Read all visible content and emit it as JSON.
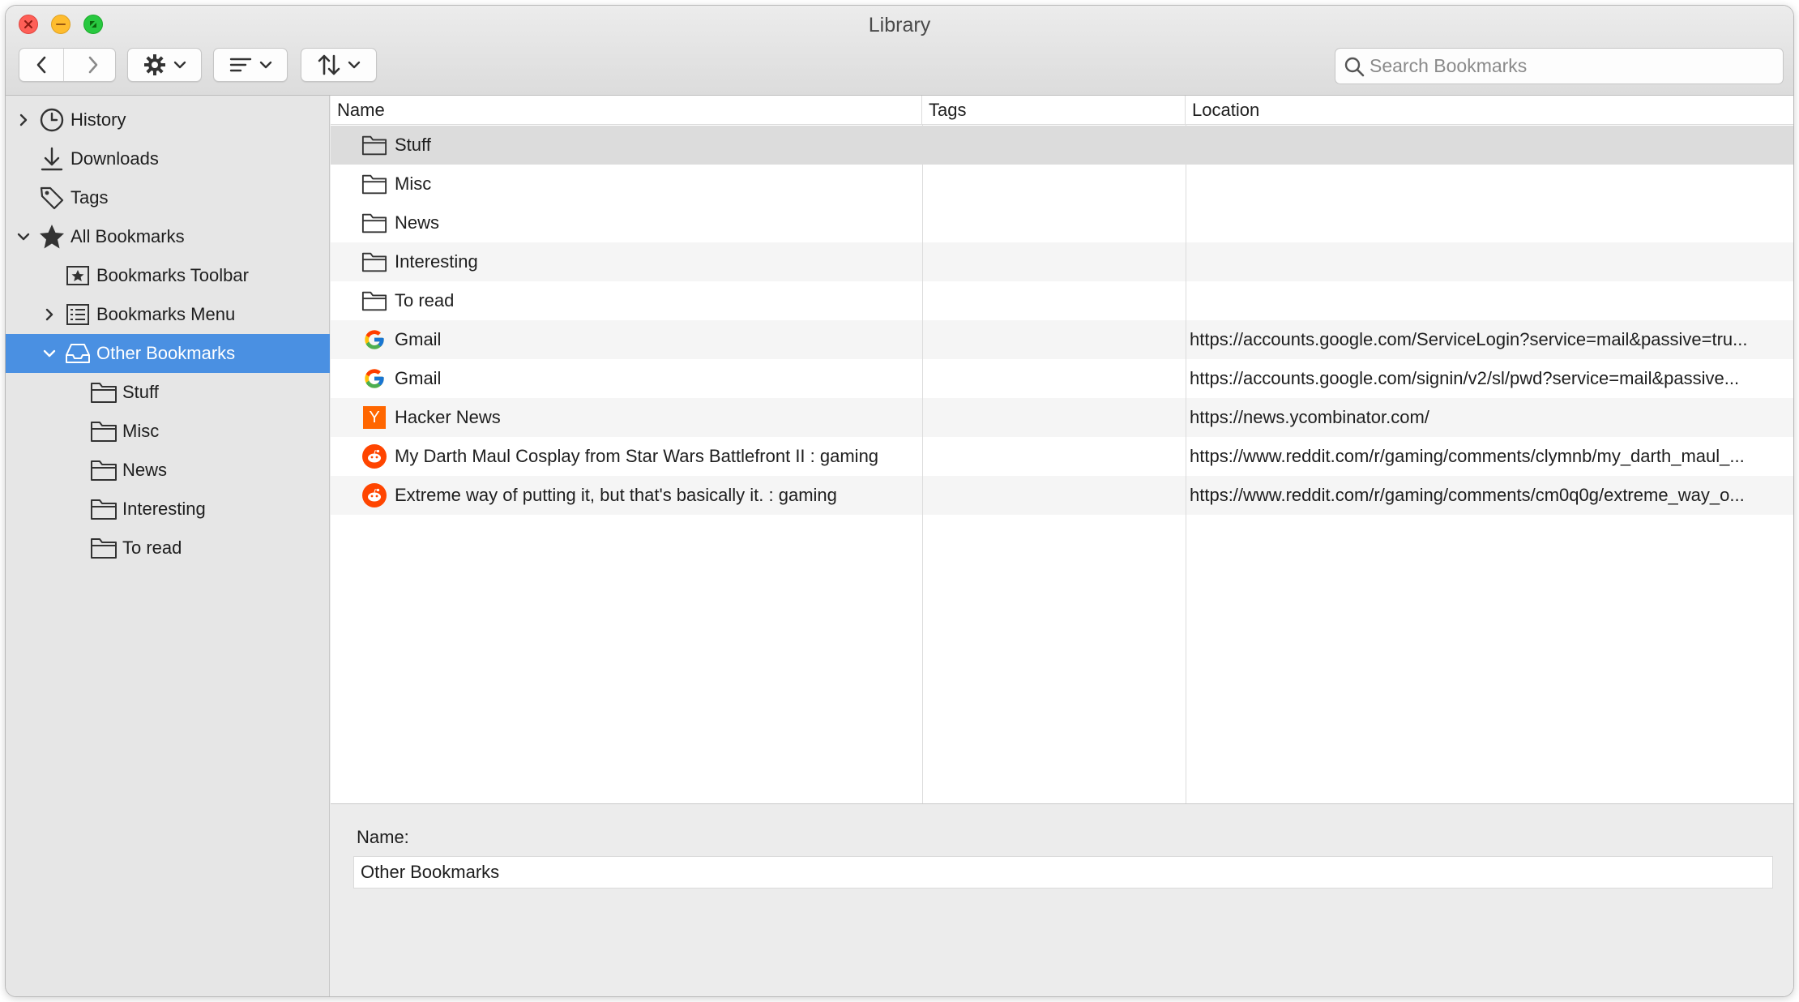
{
  "window": {
    "title": "Library"
  },
  "toolbar": {
    "back_icon": "chevron-left-icon",
    "forward_icon": "chevron-right-icon",
    "organize_icon": "gear-icon",
    "views_icon": "list-icon",
    "import_export_icon": "arrows-updown-icon",
    "search_placeholder": "Search Bookmarks"
  },
  "sidebar": {
    "items": [
      {
        "label": "History",
        "icon": "clock-icon"
      },
      {
        "label": "Downloads",
        "icon": "download-icon"
      },
      {
        "label": "Tags",
        "icon": "tag-icon"
      },
      {
        "label": "All Bookmarks",
        "icon": "star-icon"
      },
      {
        "label": "Bookmarks Toolbar",
        "icon": "bookmark-toolbar-icon"
      },
      {
        "label": "Bookmarks Menu",
        "icon": "bookmark-menu-icon"
      },
      {
        "label": "Other Bookmarks",
        "icon": "inbox-icon"
      },
      {
        "label": "Stuff",
        "icon": "folder-icon"
      },
      {
        "label": "Misc",
        "icon": "folder-icon"
      },
      {
        "label": "News",
        "icon": "folder-icon"
      },
      {
        "label": "Interesting",
        "icon": "folder-icon"
      },
      {
        "label": "To read",
        "icon": "folder-icon"
      }
    ]
  },
  "table": {
    "columns": [
      "Name",
      "Tags",
      "Location"
    ],
    "rows": [
      {
        "name": "Stuff",
        "tags": "",
        "location": "",
        "icon": "folder-icon"
      },
      {
        "name": "Misc",
        "tags": "",
        "location": "",
        "icon": "folder-icon"
      },
      {
        "name": "News",
        "tags": "",
        "location": "",
        "icon": "folder-icon"
      },
      {
        "name": "Interesting",
        "tags": "",
        "location": "",
        "icon": "folder-icon"
      },
      {
        "name": "To read",
        "tags": "",
        "location": "",
        "icon": "folder-icon"
      },
      {
        "name": "Gmail",
        "tags": "",
        "location": "https://accounts.google.com/ServiceLogin?service=mail&passive=tru...",
        "icon": "google-icon"
      },
      {
        "name": "Gmail",
        "tags": "",
        "location": "https://accounts.google.com/signin/v2/sl/pwd?service=mail&passive...",
        "icon": "google-icon"
      },
      {
        "name": "Hacker News",
        "tags": "",
        "location": "https://news.ycombinator.com/",
        "icon": "ycombinator-icon"
      },
      {
        "name": "My Darth Maul Cosplay from Star Wars Battlefront II : gaming",
        "tags": "",
        "location": "https://www.reddit.com/r/gaming/comments/clymnb/my_darth_maul_...",
        "icon": "reddit-icon"
      },
      {
        "name": "Extreme way of putting it, but that's basically it. : gaming",
        "tags": "",
        "location": "https://www.reddit.com/r/gaming/comments/cm0q0g/extreme_way_o...",
        "icon": "reddit-icon"
      }
    ]
  },
  "details": {
    "name_label": "Name:",
    "name_value": "Other Bookmarks"
  }
}
